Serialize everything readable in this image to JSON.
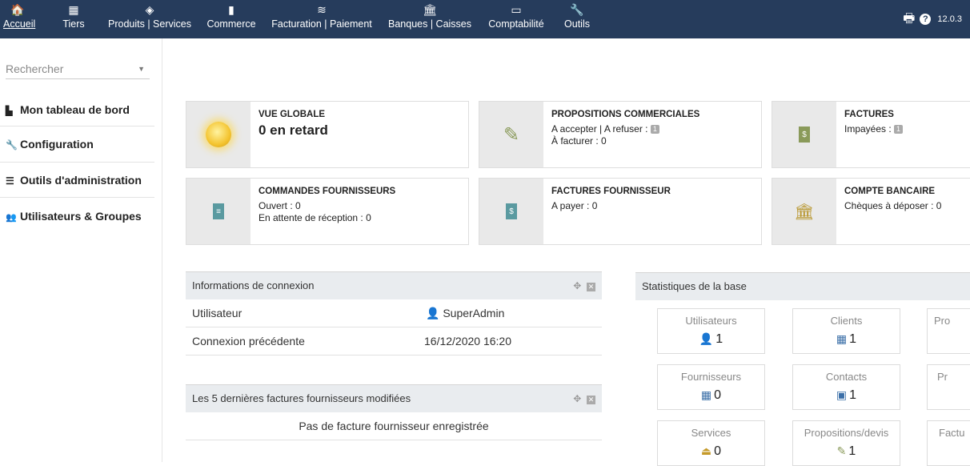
{
  "menu": [
    {
      "label": "Accueil",
      "icon": "home-icon",
      "glyph": "🏠"
    },
    {
      "label": "Tiers",
      "icon": "building-icon",
      "glyph": "▦"
    },
    {
      "label": "Produits | Services",
      "icon": "cube-icon",
      "glyph": "◈"
    },
    {
      "label": "Commerce",
      "icon": "briefcase-icon",
      "glyph": "▮"
    },
    {
      "label": "Facturation | Paiement",
      "icon": "coins-icon",
      "glyph": "≋"
    },
    {
      "label": "Banques | Caisses",
      "icon": "bank-icon",
      "glyph": "🏛"
    },
    {
      "label": "Comptabilité",
      "icon": "money-bill-icon",
      "glyph": "▭"
    },
    {
      "label": "Outils",
      "icon": "wrench-icon",
      "glyph": "🔧"
    }
  ],
  "topright": {
    "print_icon": "print-icon",
    "help_icon": "help-icon",
    "version": "12.0.3"
  },
  "sidebar": {
    "search_placeholder": "Rechercher",
    "items": [
      {
        "label": "Mon tableau de bord",
        "icon": "chart-icon",
        "glyph": "📊"
      },
      {
        "label": "Configuration",
        "icon": "wrench-icon",
        "glyph": "🔧"
      },
      {
        "label": "Outils d'administration",
        "icon": "server-icon",
        "glyph": "☰"
      },
      {
        "label": "Utilisateurs & Groupes",
        "icon": "users-icon",
        "glyph": "👥"
      }
    ]
  },
  "boxes": {
    "vue_globale": {
      "title": "VUE GLOBALE",
      "line1": "0 en retard"
    },
    "propositions": {
      "title": "PROPOSITIONS COMMERCIALES",
      "line1": "A accepter | A refuser : ",
      "badge1": "1",
      "line2": "À facturer : 0"
    },
    "factures": {
      "title": "FACTURES",
      "line1": "Impayées : ",
      "badge1": "1"
    },
    "commandes": {
      "title": "COMMANDES FOURNISSEURS",
      "line1": "Ouvert : 0",
      "line2": "En attente de réception : 0"
    },
    "factures_fourn": {
      "title": "FACTURES FOURNISSEUR",
      "line1": "A payer : 0"
    },
    "compte": {
      "title": "COMPTE BANCAIRE",
      "line1": "Chèques à déposer : 0"
    }
  },
  "connexion": {
    "title": "Informations de connexion",
    "rows": [
      {
        "label": "Utilisateur",
        "value": "SuperAdmin"
      },
      {
        "label": "Connexion précédente",
        "value": "16/12/2020 16:20"
      }
    ]
  },
  "dernieres": {
    "title": "Les 5 dernières factures fournisseurs modifiées",
    "empty": "Pas de facture fournisseur enregistrée"
  },
  "stats": {
    "title": "Statistiques de la base",
    "cards": [
      {
        "label": "Utilisateurs",
        "value": "1",
        "icon": "user-icon",
        "glyph": "👤",
        "color": "#a07c3c"
      },
      {
        "label": "Clients",
        "value": "1",
        "icon": "building-icon",
        "glyph": "▦",
        "color": "#3b6fa8"
      },
      {
        "label": "Pro",
        "value": "",
        "icon": "product-icon",
        "glyph": "",
        "color": "#c59a2a"
      },
      {
        "label": "Fournisseurs",
        "value": "0",
        "icon": "building-icon",
        "glyph": "▦",
        "color": "#3b6fa8"
      },
      {
        "label": "Contacts",
        "value": "1",
        "icon": "contact-card-icon",
        "glyph": "▣",
        "color": "#3b6fa8"
      },
      {
        "label": "Pr",
        "value": "",
        "icon": "product-icon",
        "glyph": "",
        "color": "#c59a2a"
      },
      {
        "label": "Services",
        "value": "0",
        "icon": "concierge-bell-icon",
        "glyph": "⏏",
        "color": "#c59a2a"
      },
      {
        "label": "Propositions/devis",
        "value": "1",
        "icon": "proposal-icon",
        "glyph": "✎",
        "color": "#8a9a5a"
      },
      {
        "label": "Factu",
        "value": "",
        "icon": "invoice-icon",
        "glyph": "",
        "color": "#8a9a5a"
      }
    ]
  }
}
